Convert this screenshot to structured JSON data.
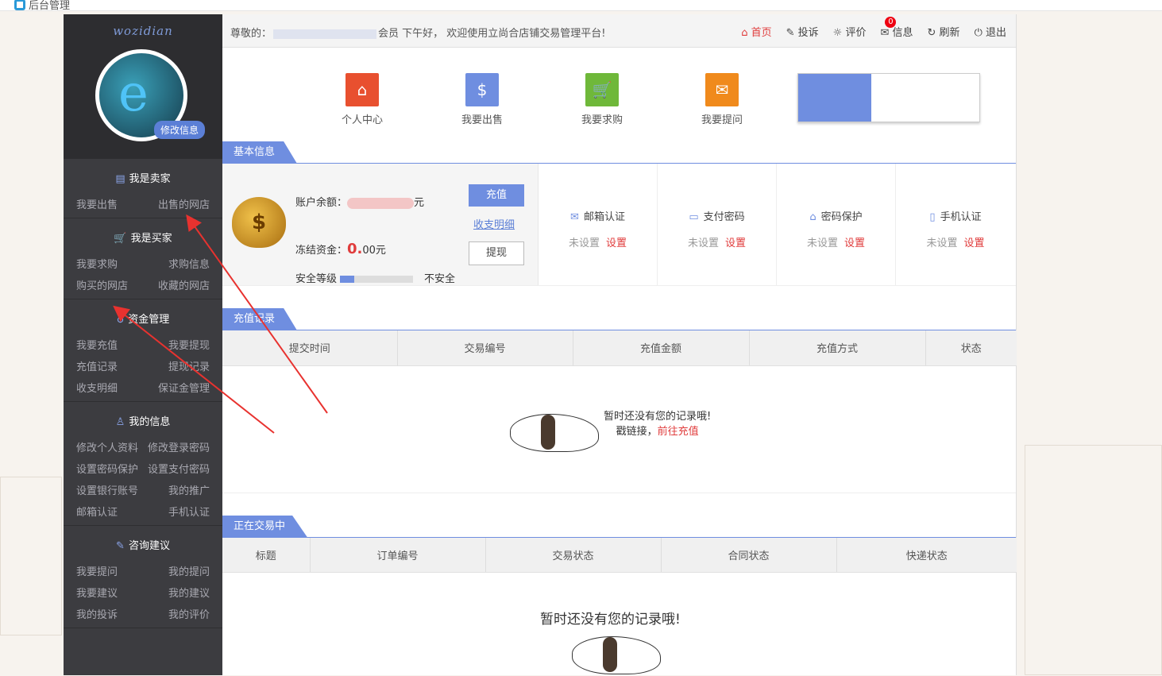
{
  "browser": {
    "tab_title": "后台管理"
  },
  "sidebar": {
    "brand": "wozidian",
    "edit_badge": "修改信息",
    "groups": [
      {
        "title": "我是卖家",
        "icon": "clipboard-icon",
        "links": [
          "我要出售",
          "出售的网店"
        ]
      },
      {
        "title": "我是买家",
        "icon": "cart-icon",
        "links": [
          "我要求购",
          "求购信息",
          "购买的网店",
          "收藏的网店"
        ]
      },
      {
        "title": "资金管理",
        "icon": "money-bag-icon",
        "links": [
          "我要充值",
          "我要提现",
          "充值记录",
          "提现记录",
          "收支明细",
          "保证金管理"
        ]
      },
      {
        "title": "我的信息",
        "icon": "user-icon",
        "links": [
          "修改个人资料",
          "修改登录密码",
          "设置密码保护",
          "设置支付密码",
          "设置银行账号",
          "我的推广",
          "邮箱认证",
          "手机认证"
        ]
      },
      {
        "title": "咨询建议",
        "icon": "edit-icon",
        "links": [
          "我要提问",
          "我的提问",
          "我要建议",
          "我的建议",
          "我的投诉",
          "我的评价"
        ]
      }
    ]
  },
  "header": {
    "greeting_prefix": "尊敬的：",
    "greeting_suffix": "会员 下午好， 欢迎使用立尚合店铺交易管理平台!",
    "nav": [
      {
        "label": "首页",
        "icon": "⌂",
        "active": true
      },
      {
        "label": "投诉",
        "icon": "✎",
        "active": false
      },
      {
        "label": "评价",
        "icon": "☼",
        "active": false
      },
      {
        "label": "信息",
        "icon": "✉",
        "active": false,
        "badge": "0"
      },
      {
        "label": "刷新",
        "icon": "↻",
        "active": false
      },
      {
        "label": "退出",
        "icon": "⏻",
        "active": false
      }
    ]
  },
  "shortcuts": [
    {
      "label": "个人中心",
      "color": "#e8502f",
      "icon": "⌂"
    },
    {
      "label": "我要出售",
      "color": "#6f8ee0",
      "icon": "$"
    },
    {
      "label": "我要求购",
      "color": "#6fb83a",
      "icon": "🛒"
    },
    {
      "label": "我要提问",
      "color": "#f08a1c",
      "icon": "✉"
    }
  ],
  "basic_info": {
    "section_title": "基本信息",
    "balance_label": "账户余额：",
    "balance_unit": "元",
    "frozen_label": "冻结资金：",
    "frozen_value": "0.",
    "frozen_tail": "00元",
    "security_label": "安全等级",
    "security_level_fraction": 0.2,
    "security_text": "不安全",
    "recharge_button": "充值",
    "statement_link": "收支明细",
    "withdraw_button": "提现",
    "items": [
      {
        "name": "邮箱认证",
        "icon": "✉",
        "status": "未设置",
        "action": "设置"
      },
      {
        "name": "支付密码",
        "icon": "▭",
        "status": "未设置",
        "action": "设置"
      },
      {
        "name": "密码保护",
        "icon": "⌂",
        "status": "未设置",
        "action": "设置"
      },
      {
        "name": "手机认证",
        "icon": "▯",
        "status": "未设置",
        "action": "设置"
      }
    ]
  },
  "recharge": {
    "section_title": "充值记录",
    "columns": [
      "提交时间",
      "交易编号",
      "充值金额",
      "充值方式",
      "状态"
    ],
    "empty_line1": "暂时还没有您的记录哦!",
    "empty_line2": "戳链接，",
    "empty_link": "前往充值"
  },
  "trading": {
    "section_title": "正在交易中",
    "columns": [
      "标题",
      "订单编号",
      "交易状态",
      "合同状态",
      "快递状态"
    ],
    "empty_text": "暂时还没有您的记录哦!"
  }
}
